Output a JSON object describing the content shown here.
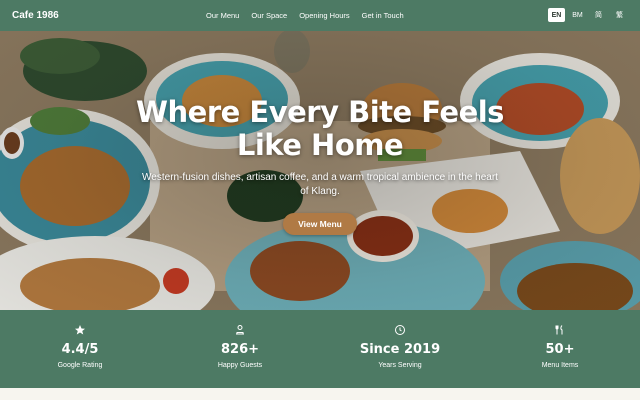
{
  "nav": {
    "brand": "Cafe 1986",
    "links": [
      "Our Menu",
      "Our Space",
      "Opening Hours",
      "Get in Touch"
    ],
    "languages": [
      "EN",
      "BM",
      "简",
      "繁"
    ],
    "active_language": "EN"
  },
  "hero": {
    "title": "Where Every Bite Feels Like Home",
    "subtitle": "Western-fusion dishes, artisan coffee, and a warm tropical ambience in the heart of Klang.",
    "cta_label": "View Menu"
  },
  "stats": [
    {
      "icon": "star-icon",
      "value": "4.4/5",
      "label": "Google Rating"
    },
    {
      "icon": "guests-icon",
      "value": "826+",
      "label": "Happy Guests"
    },
    {
      "icon": "clock-icon",
      "value": "Since 2019",
      "label": "Years Serving"
    },
    {
      "icon": "utensils-icon",
      "value": "50+",
      "label": "Menu Items"
    }
  ],
  "colors": {
    "brand_green": "#4d7a64",
    "cta_brown": "#b07a45"
  }
}
